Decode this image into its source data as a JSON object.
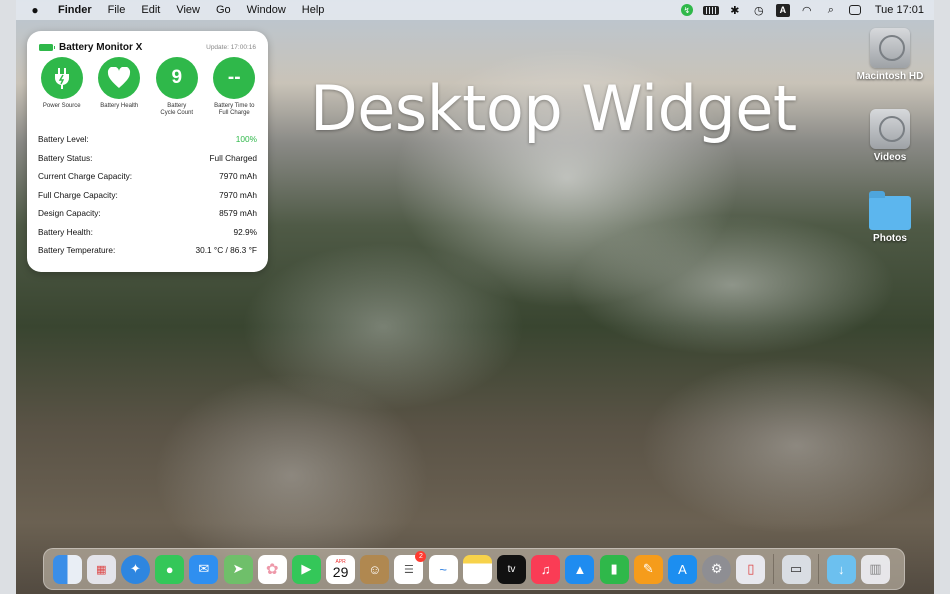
{
  "menubar": {
    "apple": "",
    "items": [
      "Finder",
      "File",
      "Edit",
      "View",
      "Go",
      "Window",
      "Help"
    ],
    "status": {
      "input_label": "A",
      "clock": "Tue 17:01"
    }
  },
  "widget": {
    "title": "Battery Monitor X",
    "update": "Update: 17:00:16",
    "circles": [
      {
        "value": "",
        "icon": "plug-icon",
        "label": "Power Source"
      },
      {
        "value": "",
        "icon": "heart-icon",
        "label": "Battery Health"
      },
      {
        "value": "9",
        "label": "Battery Cycle Count"
      },
      {
        "value": "--",
        "label": "Battery Time to Full Charge"
      }
    ],
    "rows": [
      {
        "label": "Battery Level:",
        "value": "100%"
      },
      {
        "label": "Battery Status:",
        "value": "Full Charged"
      },
      {
        "label": "Current Charge Capacity:",
        "value": "7970 mAh"
      },
      {
        "label": "Full Charge Capacity:",
        "value": "7970 mAh"
      },
      {
        "label": "Design Capacity:",
        "value": "8579 mAh"
      },
      {
        "label": "Battery Health:",
        "value": "92.9%"
      },
      {
        "label": "Battery Temperature:",
        "value": "30.1 °C / 86.3 °F"
      }
    ],
    "accent": "#2fb84a"
  },
  "headline": "Desktop Widget",
  "desktop_icons": [
    {
      "label": "Macintosh HD",
      "icon": "hard-drive-icon"
    },
    {
      "label": "Videos",
      "icon": "hard-drive-icon"
    },
    {
      "label": "Photos",
      "icon": "folder-icon"
    }
  ],
  "dock": {
    "calendar": {
      "month": "APR",
      "day": "29"
    },
    "reminders_badge": "2",
    "tv_label": "tv"
  }
}
